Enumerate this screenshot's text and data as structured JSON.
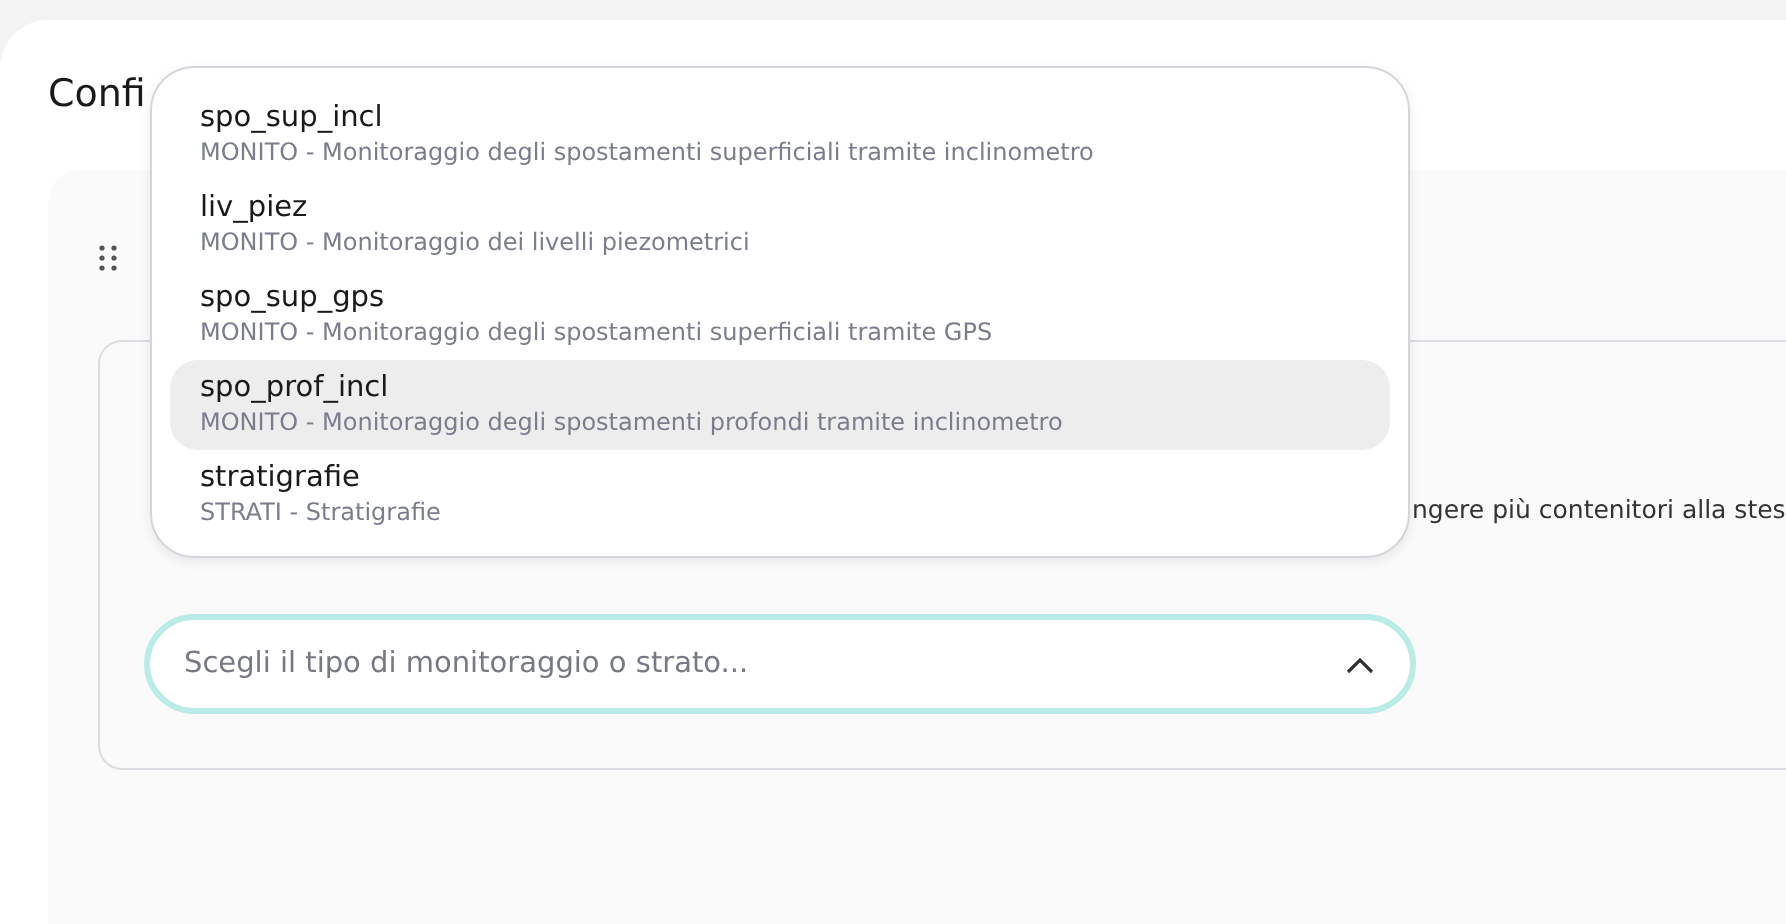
{
  "page": {
    "title": "Confi"
  },
  "container": {
    "hint": "ngere più contenitori alla stes"
  },
  "select": {
    "placeholder": "Scegli il tipo di monitoraggio o strato...",
    "expanded": true
  },
  "options": [
    {
      "code": "spo_sup_incl",
      "description": "MONITO - Monitoraggio degli spostamenti superficiali tramite inclinometro",
      "selected": false
    },
    {
      "code": "liv_piez",
      "description": "MONITO - Monitoraggio dei livelli piezometrici",
      "selected": false
    },
    {
      "code": "spo_sup_gps",
      "description": "MONITO - Monitoraggio degli spostamenti superficiali tramite GPS",
      "selected": false
    },
    {
      "code": "spo_prof_incl",
      "description": "MONITO - Monitoraggio degli spostamenti profondi tramite inclinometro",
      "selected": true
    },
    {
      "code": "stratigrafie",
      "description": "STRATI - Stratigrafie",
      "selected": false
    }
  ]
}
